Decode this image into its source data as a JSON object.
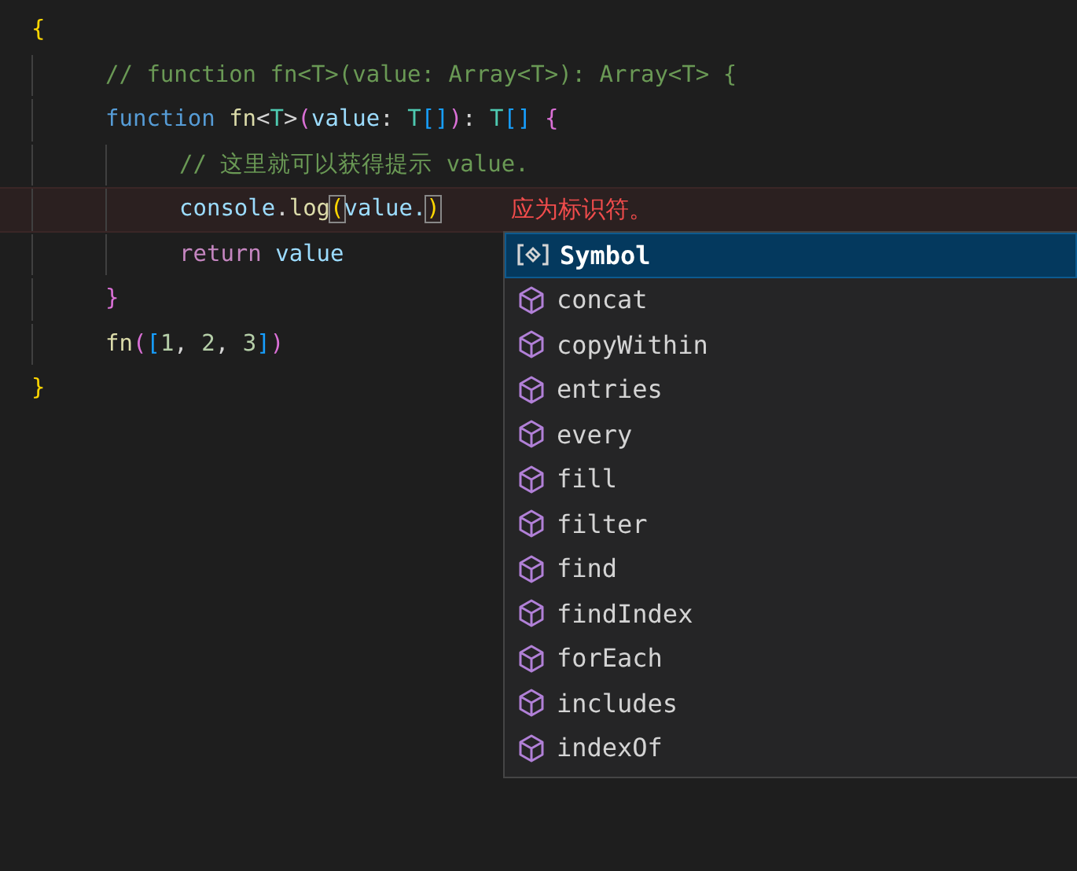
{
  "editor": {
    "lines": [
      {
        "tokens": [
          {
            "text": "{",
            "kind": "brace1"
          }
        ],
        "children": [
          {
            "tokens": [
              {
                "text": "// function fn<T>(value: Array<T>): Array<T> {",
                "kind": "comment"
              }
            ]
          },
          {
            "tokens": [
              {
                "text": "function ",
                "kind": "keyword"
              },
              {
                "text": "fn",
                "kind": "func"
              },
              {
                "text": "<",
                "kind": "plain"
              },
              {
                "text": "T",
                "kind": "type"
              },
              {
                "text": ">",
                "kind": "plain"
              },
              {
                "text": "(",
                "kind": "brace2"
              },
              {
                "text": "value",
                "kind": "var"
              },
              {
                "text": ": ",
                "kind": "plain"
              },
              {
                "text": "T",
                "kind": "type"
              },
              {
                "text": "[]",
                "kind": "brace3"
              },
              {
                "text": ")",
                "kind": "brace2"
              },
              {
                "text": ": ",
                "kind": "plain"
              },
              {
                "text": "T",
                "kind": "type"
              },
              {
                "text": "[] ",
                "kind": "brace3"
              },
              {
                "text": "{",
                "kind": "brace2"
              }
            ],
            "children": [
              {
                "tokens": [
                  {
                    "text": "// 这里就可以获得提示 value.",
                    "kind": "comment"
                  }
                ]
              },
              {
                "error": "应为标识符。",
                "tokens": [
                  {
                    "text": "console",
                    "kind": "var"
                  },
                  {
                    "text": ".",
                    "kind": "plain"
                  },
                  {
                    "text": "log",
                    "kind": "func"
                  },
                  {
                    "text": "(",
                    "kind": "match"
                  },
                  {
                    "text": "value.",
                    "kind": "var"
                  },
                  {
                    "text": ")",
                    "kind": "match"
                  }
                ]
              },
              {
                "tokens": [
                  {
                    "text": "return ",
                    "kind": "control"
                  },
                  {
                    "text": "value",
                    "kind": "var"
                  }
                ]
              }
            ]
          },
          {
            "tokens": [
              {
                "text": "}",
                "kind": "brace2"
              }
            ]
          },
          {
            "tokens": [
              {
                "text": "fn",
                "kind": "func"
              },
              {
                "text": "(",
                "kind": "brace2"
              },
              {
                "text": "[",
                "kind": "brace3"
              },
              {
                "text": "1",
                "kind": "number"
              },
              {
                "text": ", ",
                "kind": "plain"
              },
              {
                "text": "2",
                "kind": "number"
              },
              {
                "text": ", ",
                "kind": "plain"
              },
              {
                "text": "3",
                "kind": "number"
              },
              {
                "text": "]",
                "kind": "brace3"
              },
              {
                "text": ")",
                "kind": "brace2"
              }
            ]
          }
        ]
      },
      {
        "tokens": [
          {
            "text": "}",
            "kind": "brace1"
          }
        ]
      }
    ]
  },
  "suggestions": [
    {
      "label": "Symbol",
      "kind": "variable",
      "selected": true
    },
    {
      "label": "concat",
      "kind": "method",
      "selected": false
    },
    {
      "label": "copyWithin",
      "kind": "method",
      "selected": false
    },
    {
      "label": "entries",
      "kind": "method",
      "selected": false
    },
    {
      "label": "every",
      "kind": "method",
      "selected": false
    },
    {
      "label": "fill",
      "kind": "method",
      "selected": false
    },
    {
      "label": "filter",
      "kind": "method",
      "selected": false
    },
    {
      "label": "find",
      "kind": "method",
      "selected": false
    },
    {
      "label": "findIndex",
      "kind": "method",
      "selected": false
    },
    {
      "label": "forEach",
      "kind": "method",
      "selected": false
    },
    {
      "label": "includes",
      "kind": "method",
      "selected": false
    },
    {
      "label": "indexOf",
      "kind": "method",
      "selected": false
    }
  ]
}
